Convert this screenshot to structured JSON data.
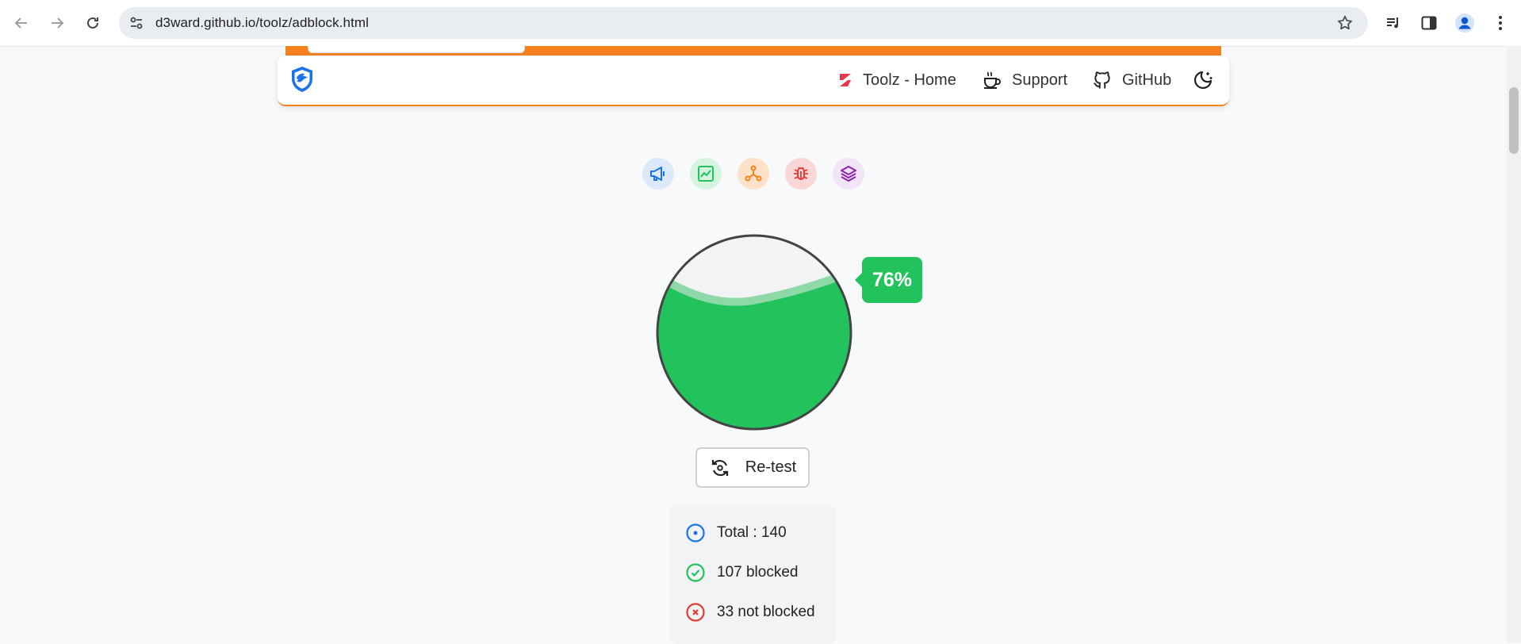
{
  "browser": {
    "url": "d3ward.github.io/toolz/adblock.html",
    "back_icon": "arrow-left-icon",
    "forward_icon": "arrow-right-icon",
    "reload_icon": "reload-icon"
  },
  "navbar": {
    "links": [
      {
        "label": "Toolz - Home",
        "icon": "toolz-logo-icon"
      },
      {
        "label": "Support",
        "icon": "coffee-icon"
      },
      {
        "label": "GitHub",
        "icon": "github-icon"
      }
    ]
  },
  "categories": [
    {
      "name": "ads",
      "icon": "megaphone-icon",
      "color": "#1a73e8",
      "bg": "#dbe9fb"
    },
    {
      "name": "analytics",
      "icon": "chart-icon",
      "color": "#22c35d",
      "bg": "#d4f4df"
    },
    {
      "name": "social",
      "icon": "network-icon",
      "color": "#f4821f",
      "bg": "#fde2c9"
    },
    {
      "name": "error-trackers",
      "icon": "bug-icon",
      "color": "#e53935",
      "bg": "#fbd6d6"
    },
    {
      "name": "mix",
      "icon": "layers-icon",
      "color": "#8e24aa",
      "bg": "#f1e4f7"
    }
  ],
  "gauge": {
    "percent_label": "76%",
    "fill_fraction": 0.76,
    "fill_color": "#22c35d"
  },
  "retest": {
    "label": "Re-test"
  },
  "stats": {
    "total": "Total : 140",
    "blocked": "107 blocked",
    "not_blocked": "33 not blocked"
  }
}
